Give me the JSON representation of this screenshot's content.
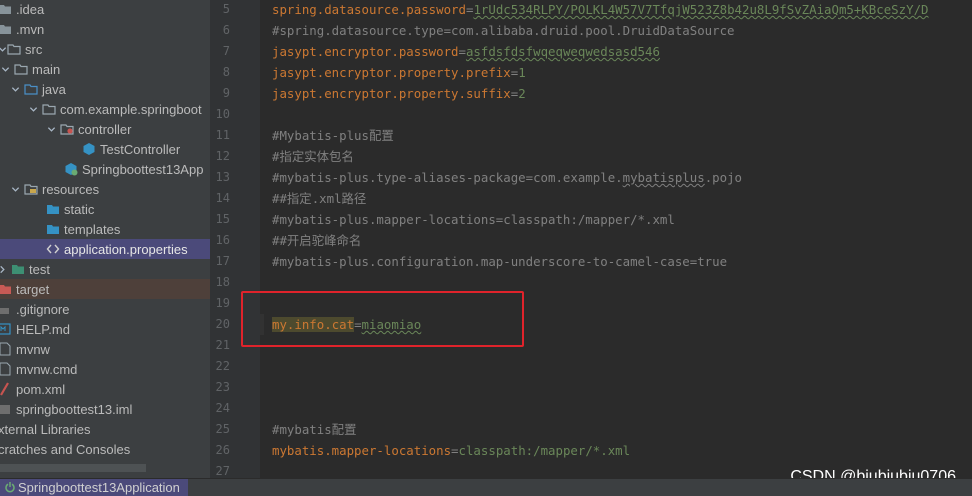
{
  "tree": {
    "items": [
      {
        "label": ".idea",
        "icon": "folder-icon"
      },
      {
        "label": ".mvn",
        "icon": "folder-icon"
      },
      {
        "label": "src",
        "icon": "folder-icon"
      },
      {
        "label": "main",
        "icon": "folder-icon"
      },
      {
        "label": "java",
        "icon": "source-folder-icon"
      },
      {
        "label": "com.example.springboot",
        "icon": "package-icon"
      },
      {
        "label": "controller",
        "icon": "package-icon"
      },
      {
        "label": "TestController",
        "icon": "class-icon"
      },
      {
        "label": "Springboottest13App",
        "icon": "spring-class-icon"
      },
      {
        "label": "resources",
        "icon": "resources-folder-icon"
      },
      {
        "label": "static",
        "icon": "folder-icon"
      },
      {
        "label": "templates",
        "icon": "folder-icon"
      },
      {
        "label": "application.properties",
        "icon": "properties-file-icon"
      },
      {
        "label": "test",
        "icon": "test-folder-icon"
      },
      {
        "label": "target",
        "icon": "folder-icon"
      },
      {
        "label": ".gitignore",
        "icon": "gitignore-icon"
      },
      {
        "label": "HELP.md",
        "icon": "markdown-icon"
      },
      {
        "label": "mvnw",
        "icon": "file-icon"
      },
      {
        "label": "mvnw.cmd",
        "icon": "file-icon"
      },
      {
        "label": "pom.xml",
        "icon": "maven-icon"
      },
      {
        "label": "springboottest13.iml",
        "icon": "iml-icon"
      },
      {
        "label": "xternal Libraries",
        "icon": ""
      },
      {
        "label": "cratches and Consoles",
        "icon": ""
      }
    ]
  },
  "editor": {
    "line_numbers": [
      "5",
      "6",
      "7",
      "8",
      "9",
      "10",
      "11",
      "12",
      "13",
      "14",
      "15",
      "16",
      "17",
      "18",
      "19",
      "20",
      "21",
      "22",
      "23",
      "24",
      "25",
      "26",
      "27"
    ],
    "lines": {
      "l5_key": "spring.datasource.password",
      "l5_val": "1rUdc534RLPY/POLKL4W57V7TfqjW523Z8b42u8L9fSvZAiaQm5+KBceSzY/D",
      "l6": "#spring.datasource.type=com.alibaba.druid.pool.DruidDataSource",
      "l7_key": "jasypt.encryptor.password",
      "l7_val": "asfdsfdsfwqeqweqwedsasd546",
      "l8_key": "jasypt.encryptor.property.prefix",
      "l8_val": "1",
      "l9_key": "jasypt.encryptor.property.suffix",
      "l9_val": "2",
      "l11": "#Mybatis-plus配置",
      "l12": "#指定实体包名",
      "l13_a": "#mybatis-plus.type-aliases-package=com.example.",
      "l13_b": "mybatisplus",
      "l13_c": ".pojo",
      "l14": "##指定.xml路径",
      "l15": "#mybatis-plus.mapper-locations=classpath:/mapper/*.xml",
      "l16": "##开启驼峰命名",
      "l17": "#mybatis-plus.configuration.map-underscore-to-camel-case=true",
      "l20_key_a": "my.info.",
      "l20_key_b": "cat",
      "l20_val": "miaomiao",
      "l25": "#mybatis配置",
      "l26_key": "mybatis.mapper-locations",
      "l26_val": "classpath:/mapper/*.xml",
      "eq": "="
    }
  },
  "bottom": {
    "run_tab": "Springboottest13Application"
  },
  "watermark": "CSDN @biubiubiu0706",
  "colors": {
    "key": "#cc7832",
    "value": "#6a8759",
    "comment": "#808080",
    "highlight_box": "#e0232b",
    "selection": "#4b4a7a"
  }
}
